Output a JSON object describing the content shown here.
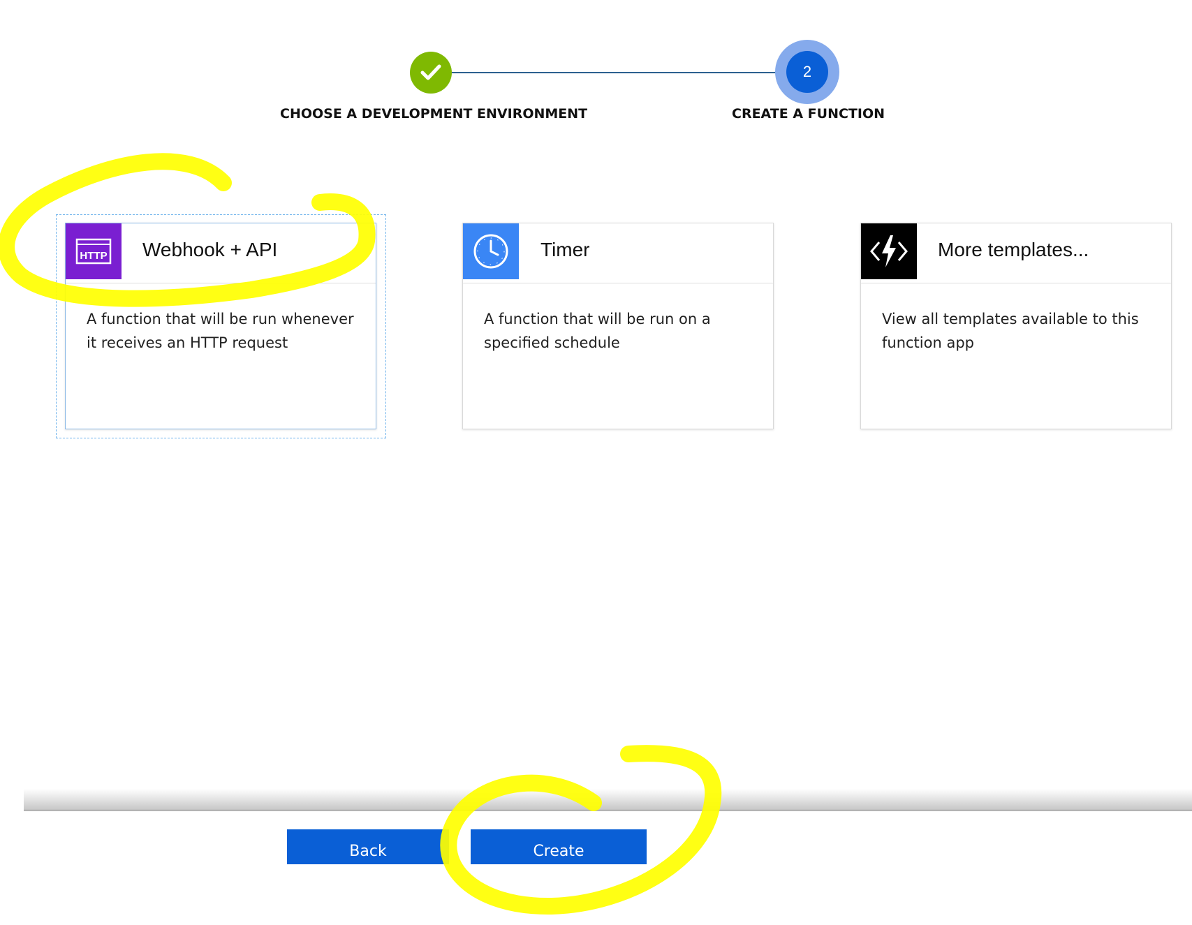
{
  "wizard": {
    "steps": [
      {
        "label": "CHOOSE A DEVELOPMENT ENVIRONMENT",
        "state": "completed"
      },
      {
        "label": "CREATE A FUNCTION",
        "number": "2",
        "state": "active"
      }
    ]
  },
  "templates": [
    {
      "title": "Webhook + API",
      "description": "A function that will be run whenever it receives an HTTP request",
      "icon": "http-icon",
      "icon_text": "HTTP",
      "icon_bg": "#7a1fd1",
      "selected": true
    },
    {
      "title": "Timer",
      "description": "A function that will be run on a specified schedule",
      "icon": "clock-icon",
      "icon_bg": "#3a86f5",
      "selected": false
    },
    {
      "title": "More templates...",
      "description": "View all templates available to this function app",
      "icon": "function-bolt-icon",
      "icon_bg": "#000000",
      "selected": false
    }
  ],
  "footer": {
    "back_label": "Back",
    "create_label": "Create"
  },
  "colors": {
    "accent_blue": "#0a5fd6",
    "completed_green": "#7fb902",
    "highlighter_yellow": "#ffff00"
  }
}
